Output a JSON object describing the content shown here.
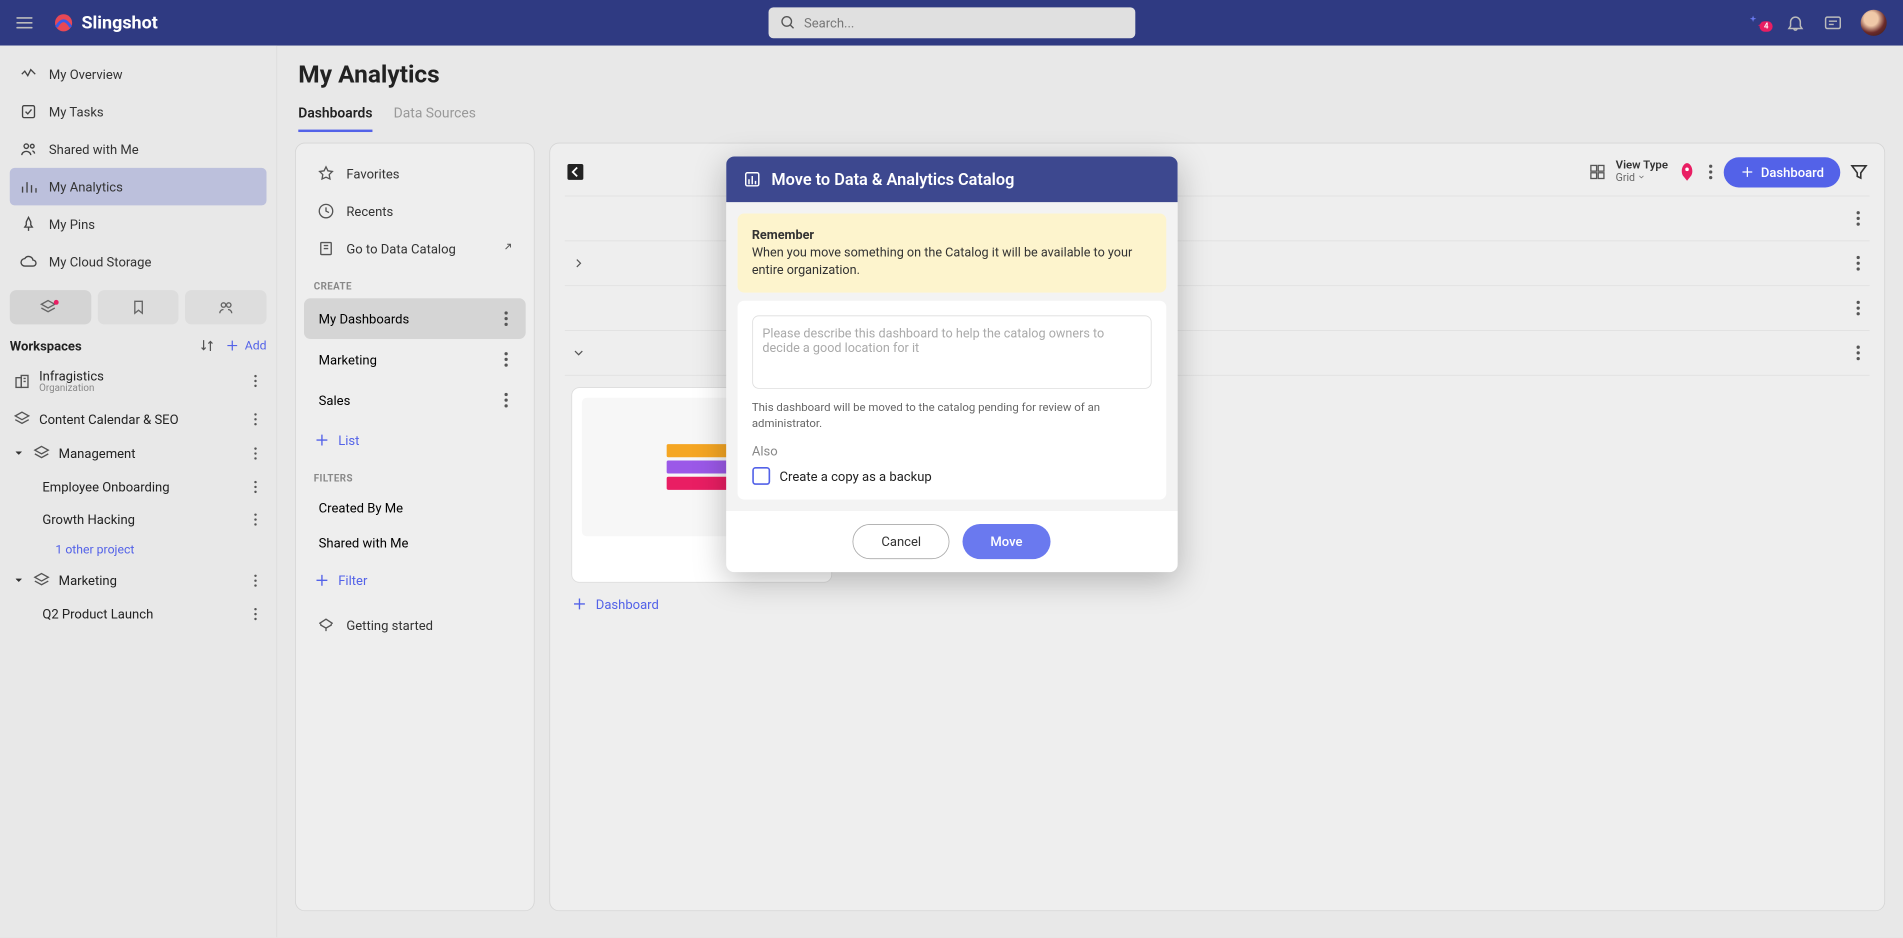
{
  "header": {
    "app_name": "Slingshot",
    "search_placeholder": "Search...",
    "notification_badge": "4"
  },
  "sidebar": {
    "items": [
      {
        "label": "My Overview"
      },
      {
        "label": "My Tasks"
      },
      {
        "label": "Shared with Me"
      },
      {
        "label": "My Analytics"
      },
      {
        "label": "My Pins"
      },
      {
        "label": "My Cloud Storage"
      }
    ],
    "workspaces_heading": "Workspaces",
    "add_label": "Add",
    "workspaces": [
      {
        "label": "Infragistics",
        "sub": "Organization"
      },
      {
        "label": "Content Calendar & SEO"
      },
      {
        "label": "Management",
        "expanded": true,
        "children": [
          {
            "label": "Employee Onboarding"
          },
          {
            "label": "Growth Hacking"
          }
        ],
        "other": "1 other project"
      },
      {
        "label": "Marketing",
        "expanded": true,
        "children": [
          {
            "label": "Q2 Product Launch"
          }
        ]
      }
    ]
  },
  "page": {
    "title": "My Analytics",
    "tabs": [
      {
        "label": "Dashboards",
        "active": true
      },
      {
        "label": "Data Sources",
        "active": false
      }
    ]
  },
  "panel_nav": {
    "top": [
      {
        "label": "Favorites"
      },
      {
        "label": "Recents"
      },
      {
        "label": "Go to Data Catalog"
      }
    ],
    "create_heading": "CREATE",
    "lists": [
      {
        "label": "My Dashboards",
        "active": true
      },
      {
        "label": "Marketing"
      },
      {
        "label": "Sales"
      }
    ],
    "add_list": "List",
    "filters_heading": "FILTERS",
    "filters": [
      {
        "label": "Created By Me"
      },
      {
        "label": "Shared with Me"
      }
    ],
    "add_filter": "Filter",
    "getting_started": "Getting started"
  },
  "content": {
    "view_type_label": "View Type",
    "view_type_value": "Grid",
    "dashboard_button": "Dashboard",
    "add_dashboard": "Dashboard"
  },
  "modal": {
    "title": "Move to Data & Analytics Catalog",
    "warn_title": "Remember",
    "warn_body": "When you move something on the Catalog it will be available to your entire organization.",
    "textarea_placeholder": "Please describe this dashboard to help the catalog owners to decide a good location for it",
    "note": "This dashboard will be moved to the catalog pending for review of an administrator.",
    "also_label": "Also",
    "checkbox_label": "Create a copy as a backup",
    "cancel": "Cancel",
    "move": "Move"
  }
}
